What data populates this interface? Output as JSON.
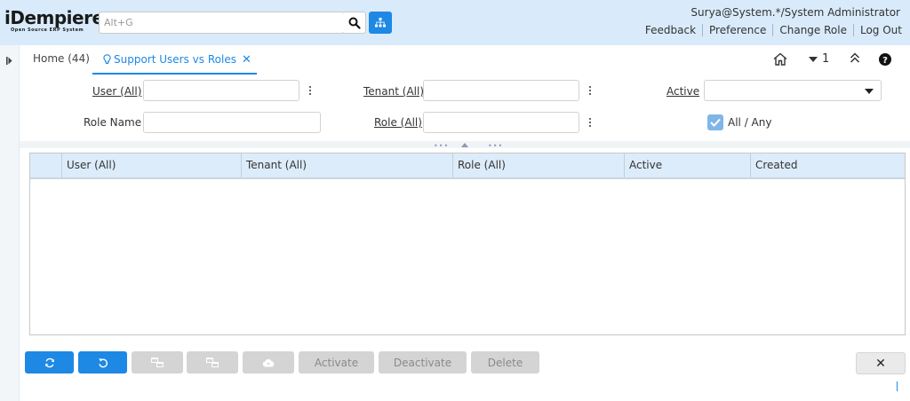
{
  "app": {
    "logo_text": "iDempiere",
    "logo_subtitle": "Open Source ERP System",
    "search_placeholder": "Alt+G"
  },
  "header": {
    "user_info": "Surya@System.*/System Administrator",
    "links": [
      "Feedback",
      "Preference",
      "Change Role",
      "Log Out"
    ]
  },
  "tabs": {
    "home": "Home (44)",
    "active": "Support Users vs Roles"
  },
  "toolbar": {
    "window_count": "1"
  },
  "query": {
    "user_label": "User (All)",
    "tenant_label": "Tenant (All)",
    "active_label": "Active",
    "role_name_label": "Role Name",
    "role_label": "Role (All)",
    "all_any_label": "All / Any",
    "all_any_checked": true,
    "user_value": "",
    "tenant_value": "",
    "active_value": "",
    "role_name_value": "",
    "role_value": ""
  },
  "grid": {
    "columns": [
      "User (All)",
      "Tenant (All)",
      "Role (All)",
      "Active",
      "Created"
    ],
    "rows": []
  },
  "buttons": {
    "activate": "Activate",
    "deactivate": "Deactivate",
    "delete": "Delete",
    "close": "✕"
  },
  "colors": {
    "accent": "#1e88e5",
    "header_bg": "#d9ebfb",
    "grid_header_bg": "#ddecfa",
    "disabled_bg": "#d4d4d4"
  },
  "icons": {
    "search": "search-icon",
    "tree": "sitemap-icon",
    "home": "home-icon",
    "collapse": "double-chevron-up-icon",
    "help": "help-icon",
    "refresh": "refresh-icon",
    "reset": "undo-icon",
    "export": "cloud-download-icon"
  }
}
